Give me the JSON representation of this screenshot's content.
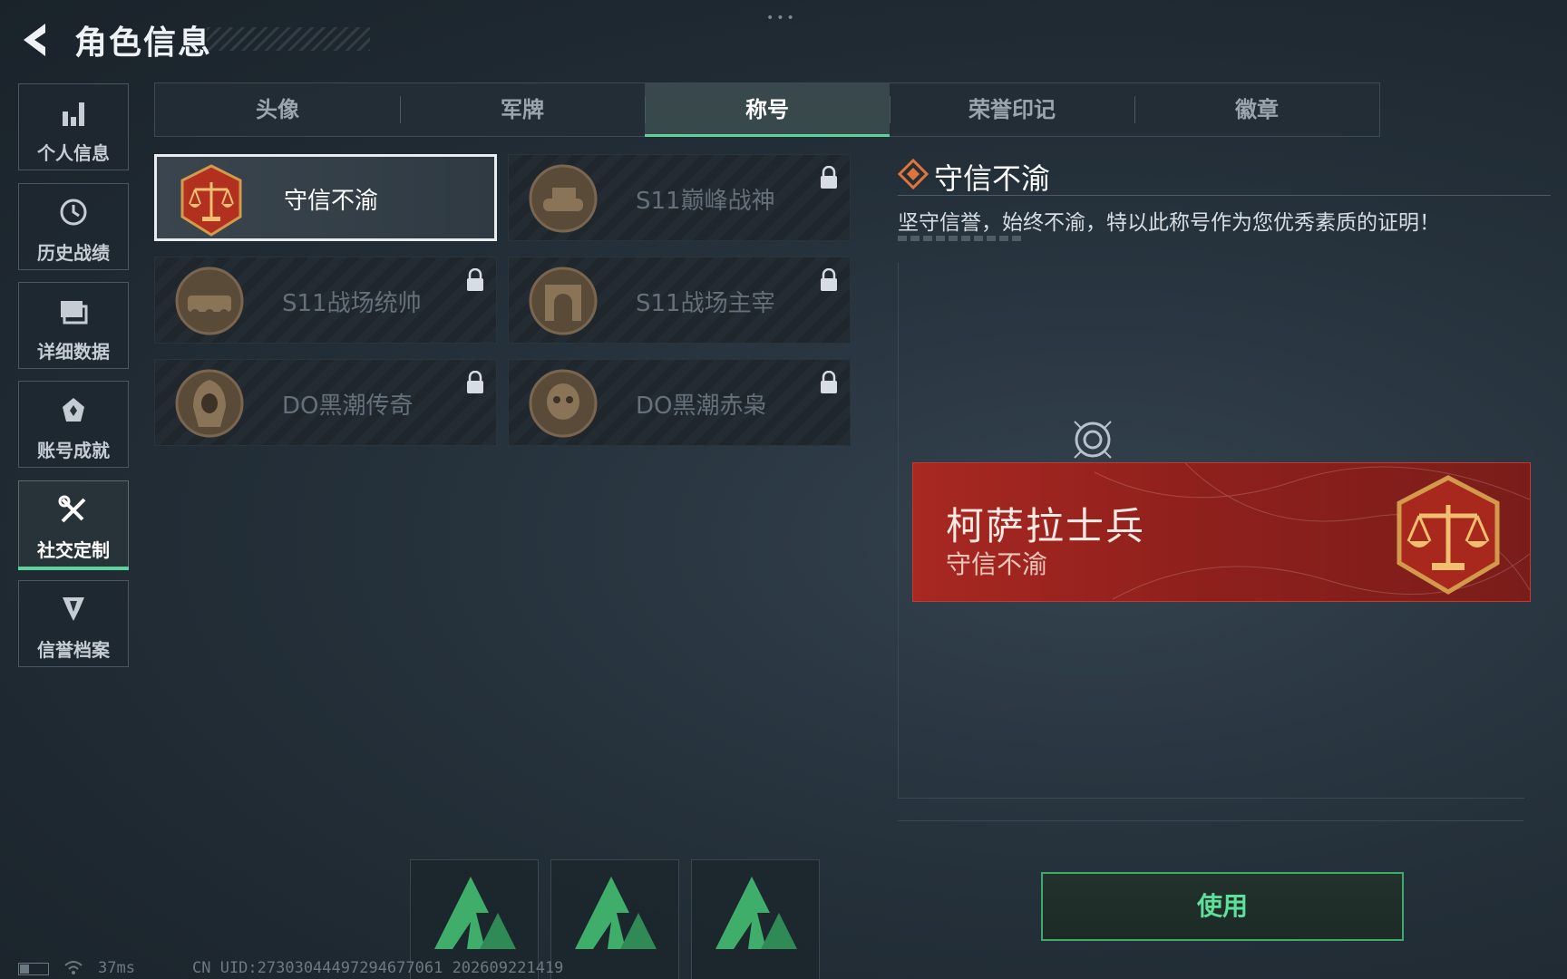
{
  "header": {
    "title": "角色信息",
    "back_icon": "back-arrow-icon"
  },
  "sidebar": {
    "items": [
      {
        "label": "个人信息",
        "icon": "bar-chart-icon",
        "active": false
      },
      {
        "label": "历史战绩",
        "icon": "history-clock-icon",
        "active": false
      },
      {
        "label": "详细数据",
        "icon": "folder-icon",
        "active": false
      },
      {
        "label": "账号成就",
        "icon": "achievement-icon",
        "active": false
      },
      {
        "label": "社交定制",
        "icon": "tools-icon",
        "active": true
      },
      {
        "label": "信誉档案",
        "icon": "shield-icon",
        "active": false
      }
    ]
  },
  "tabs": [
    {
      "label": "头像",
      "active": false
    },
    {
      "label": "军牌",
      "active": false
    },
    {
      "label": "称号",
      "active": true
    },
    {
      "label": "荣誉印记",
      "active": false
    },
    {
      "label": "徽章",
      "active": false
    }
  ],
  "titles": [
    {
      "name": "守信不渝",
      "emblem": "scales-emblem-icon",
      "locked": false,
      "selected": true
    },
    {
      "name": "S11巅峰战神",
      "emblem": "tank-emblem-icon",
      "locked": true,
      "selected": false
    },
    {
      "name": "S11战场统帅",
      "emblem": "armored-vehicle-emblem-icon",
      "locked": true,
      "selected": false
    },
    {
      "name": "S11战场主宰",
      "emblem": "arch-emblem-icon",
      "locked": true,
      "selected": false
    },
    {
      "name": "DO黑潮传奇",
      "emblem": "hooded-figure-emblem-icon",
      "locked": true,
      "selected": false
    },
    {
      "name": "DO黑潮赤枭",
      "emblem": "skull-emblem-icon",
      "locked": true,
      "selected": false
    }
  ],
  "detail": {
    "title": "守信不渝",
    "description": "坚守信誉，始终不渝，特以此称号作为您优秀素质的证明！"
  },
  "nameplate": {
    "player_name": "柯萨拉士兵",
    "title": "守信不渝",
    "color": "#a82822"
  },
  "actions": {
    "use_label": "使用"
  },
  "status_bar": {
    "ping": "37ms",
    "uid": "CN UID:27303044497294677061 202609221419"
  },
  "colors": {
    "accent": "#5dd39a",
    "background": "#222d35"
  }
}
